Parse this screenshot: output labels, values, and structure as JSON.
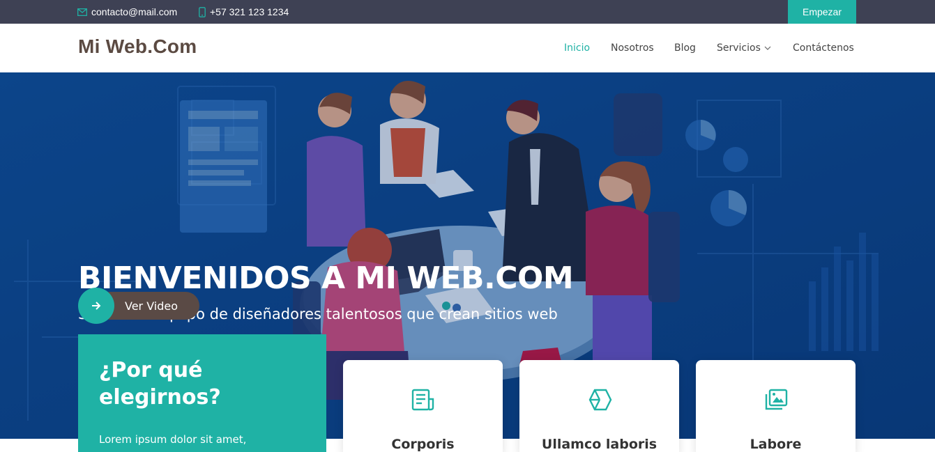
{
  "topbar": {
    "email": "contacto@mail.com",
    "phone": "+57 321 123 1234",
    "cta_label": "Empezar",
    "email_icon": "envelope-icon",
    "phone_icon": "phone-icon"
  },
  "header": {
    "logo": "Mi Web.Com",
    "nav": [
      {
        "label": "Inicio",
        "active": true
      },
      {
        "label": "Nosotros",
        "active": false
      },
      {
        "label": "Blog",
        "active": false
      },
      {
        "label": "Servicios",
        "active": false,
        "dropdown": true
      },
      {
        "label": "Contáctenos",
        "active": false
      }
    ]
  },
  "hero": {
    "title": "BIENVENIDOS A MI WEB.COM",
    "subtitle": "Somos un equipo de diseñadores talentosos que crean sitios web",
    "video_label": "Ver Video",
    "video_icon": "arrow-right-icon"
  },
  "why": {
    "title": "¿Por qué elegirnos?",
    "text": "Lorem ipsum dolor sit amet,"
  },
  "cards": [
    {
      "title": "Corporis",
      "icon": "receipt-icon"
    },
    {
      "title": "Ullamco laboris",
      "icon": "cube-icon"
    },
    {
      "title": "Labore",
      "icon": "images-icon"
    }
  ],
  "colors": {
    "accent": "#1fb2a5",
    "topbar": "#3e4154",
    "hero_bg": "#0b3f84",
    "logo": "#5b4a42"
  }
}
